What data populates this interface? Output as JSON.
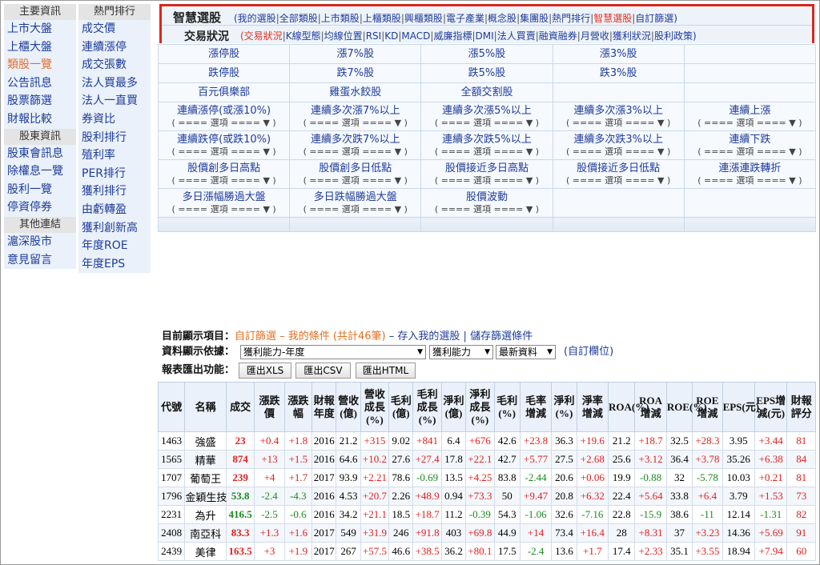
{
  "left_nav": {
    "col1": {
      "groups": [
        {
          "header": "主要資訊",
          "items": [
            "上市大盤",
            "上櫃大盤",
            "類股一覽",
            "公告訊息",
            "股票篩選",
            "財報比較"
          ],
          "active": 2
        },
        {
          "header": "股東資訊",
          "items": [
            "股東會訊息",
            "除權息一覽",
            "股利一覽",
            "停資停券"
          ]
        },
        {
          "header": "其他連結",
          "items": [
            "滬深股市",
            "意見留言"
          ]
        }
      ]
    },
    "col2": {
      "header": "熱門排行",
      "items": [
        "成交價",
        "連續漲停",
        "成交張數",
        "法人買最多",
        "法人一直買",
        "券資比",
        "股利排行",
        "殖利率",
        "PER排行",
        "獲利排行",
        "由虧轉盈",
        "獲利創新高",
        "年度ROE",
        "年度EPS"
      ]
    }
  },
  "top_menu": {
    "row1_title": "智慧選股",
    "row1_links": [
      "(我的選股",
      "全部類股",
      "上市類股",
      "上櫃類股",
      "興櫃類股",
      "電子產業",
      "概念股",
      "集團股",
      "熱門排行",
      "智慧選股",
      "自訂篩選)"
    ],
    "row1_active": 9,
    "row2_title": "交易狀況",
    "row2_links": [
      "(交易狀況",
      "K線型態",
      "均線位置",
      "RSI",
      "KD",
      "MACD",
      "威廉指標",
      "DMI",
      "法人買賣",
      "融資融券",
      "月營收",
      "獲利狀況",
      "股利政策)"
    ],
    "row2_active": 0
  },
  "screen_grid": {
    "select_text": "( ==== 選項 ==== ▼ )",
    "rows": [
      [
        {
          "t": "漲停股"
        },
        {
          "t": "漲7%股"
        },
        {
          "t": "漲5%股"
        },
        {
          "t": "漲3%股"
        },
        {
          "t": ""
        }
      ],
      [
        {
          "t": "跌停股"
        },
        {
          "t": "跌7%股"
        },
        {
          "t": "跌5%股"
        },
        {
          "t": "跌3%股"
        },
        {
          "t": ""
        }
      ],
      [
        {
          "t": "百元俱樂部"
        },
        {
          "t": "雞蛋水餃股"
        },
        {
          "t": "全額交割股"
        },
        {
          "t": ""
        },
        {
          "t": ""
        }
      ],
      [
        {
          "t": "連續漲停(或漲10%)",
          "s": true
        },
        {
          "t": "連續多次漲7%以上",
          "s": true
        },
        {
          "t": "連續多次漲5%以上",
          "s": true
        },
        {
          "t": "連續多次漲3%以上",
          "s": true
        },
        {
          "t": "連續上漲",
          "s": true
        }
      ],
      [
        {
          "t": "連續跌停(或跌10%)",
          "s": true
        },
        {
          "t": "連續多次跌7%以上",
          "s": true
        },
        {
          "t": "連續多次跌5%以上",
          "s": true
        },
        {
          "t": "連續多次跌3%以上",
          "s": true
        },
        {
          "t": "連續下跌",
          "s": true
        }
      ],
      [
        {
          "t": "股價創多日高點",
          "s": true
        },
        {
          "t": "股價創多日低點",
          "s": true
        },
        {
          "t": "股價接近多日高點",
          "s": true
        },
        {
          "t": "股價接近多日低點",
          "s": true
        },
        {
          "t": "連漲連跌轉折",
          "s": true
        }
      ],
      [
        {
          "t": "多日漲幅勝過大盤",
          "s": true
        },
        {
          "t": "多日跌幅勝過大盤",
          "s": true
        },
        {
          "t": "股價波動",
          "s": true
        },
        {
          "t": ""
        },
        {
          "t": ""
        }
      ]
    ]
  },
  "display": {
    "item_label": "目前顯示項目：",
    "item_value": "自訂篩選 – 我的條件 (共計46筆)",
    "save_link": "– 存入我的選股",
    "sep": "|",
    "store_link": "儲存篩選條件",
    "basis_label": "資料顯示依據：",
    "basis_select": "獲利能力-年度",
    "sub_select": "獲利能力",
    "date_select": "最新資料",
    "custom_link": "(自訂欄位)",
    "export_label": "報表匯出功能：",
    "export_buttons": [
      "匯出XLS",
      "匯出CSV",
      "匯出HTML"
    ]
  },
  "table": {
    "headers": [
      "代號",
      "名稱",
      "成交",
      "漲跌價",
      "漲跌幅",
      "財報年度",
      "營收(億)",
      "營收成長(%)",
      "毛利(億)",
      "毛利成長(%)",
      "淨利(億)",
      "淨利成長(%)",
      "毛利(%)",
      "毛率增減",
      "淨利(%)",
      "淨率增減",
      "ROA(%)",
      "ROA增減",
      "ROE(%)",
      "ROE增減",
      "EPS(元)",
      "EPS增減(元)",
      "財報評分"
    ],
    "rows": [
      [
        "1463",
        "強盛",
        "23",
        "+0.4",
        "+1.8",
        "2016",
        "21.2",
        "+315",
        "9.02",
        "+841",
        "6.4",
        "+676",
        "42.6",
        "+23.8",
        "36.3",
        "+19.6",
        "21.2",
        "+18.7",
        "32.5",
        "+28.3",
        "3.95",
        "+3.44",
        "81"
      ],
      [
        "1565",
        "精華",
        "874",
        "+13",
        "+1.5",
        "2016",
        "64.6",
        "+10.2",
        "27.6",
        "+27.4",
        "17.8",
        "+22.1",
        "42.7",
        "+5.77",
        "27.5",
        "+2.68",
        "25.6",
        "+3.12",
        "36.4",
        "+3.78",
        "35.26",
        "+6.38",
        "84"
      ],
      [
        "1707",
        "葡萄王",
        "239",
        "+4",
        "+1.7",
        "2017",
        "93.9",
        "+2.21",
        "78.6",
        "-0.69",
        "13.5",
        "+4.25",
        "83.8",
        "-2.44",
        "20.6",
        "+0.06",
        "19.9",
        "-0.88",
        "32",
        "-5.78",
        "10.03",
        "+0.21",
        "81"
      ],
      [
        "1796",
        "金穎生技",
        "53.8",
        "-2.4",
        "-4.3",
        "2016",
        "4.53",
        "+20.7",
        "2.26",
        "+48.9",
        "0.94",
        "+73.3",
        "50",
        "+9.47",
        "20.8",
        "+6.32",
        "22.4",
        "+5.64",
        "33.8",
        "+6.4",
        "3.79",
        "+1.53",
        "73"
      ],
      [
        "2231",
        "為升",
        "416.5",
        "-2.5",
        "-0.6",
        "2016",
        "34.2",
        "+21.1",
        "18.5",
        "+18.7",
        "11.2",
        "-0.39",
        "54.3",
        "-1.06",
        "32.6",
        "-7.16",
        "22.8",
        "-15.9",
        "38.6",
        "-11",
        "12.14",
        "-1.31",
        "82"
      ],
      [
        "2408",
        "南亞科",
        "83.3",
        "+1.3",
        "+1.6",
        "2017",
        "549",
        "+31.9",
        "246",
        "+91.8",
        "403",
        "+69.8",
        "44.9",
        "+14",
        "73.4",
        "+16.4",
        "28",
        "+8.31",
        "37",
        "+3.23",
        "14.36",
        "+5.69",
        "91"
      ],
      [
        "2439",
        "美律",
        "163.5",
        "+3",
        "+1.9",
        "2017",
        "267",
        "+57.5",
        "46.6",
        "+38.5",
        "36.2",
        "+80.1",
        "17.5",
        "-2.4",
        "13.6",
        "+1.7",
        "17.4",
        "+2.33",
        "35.1",
        "+3.55",
        "18.94",
        "+7.94",
        "60"
      ]
    ]
  }
}
